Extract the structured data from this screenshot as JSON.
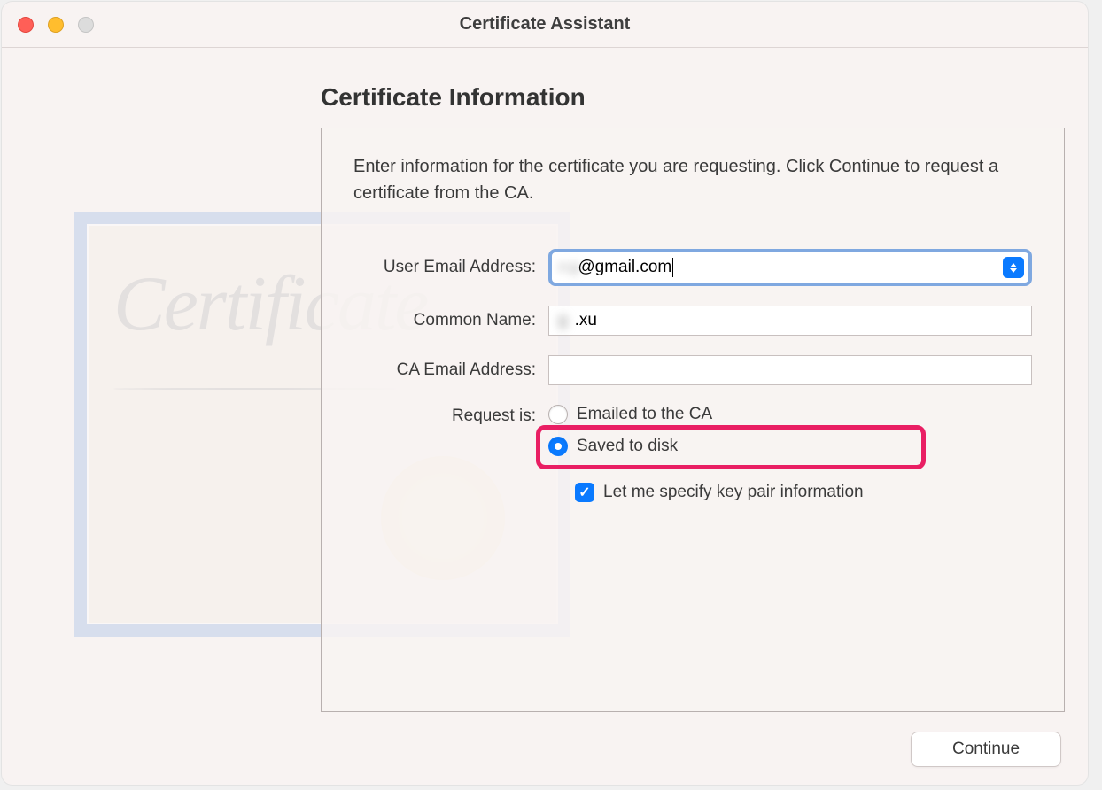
{
  "window": {
    "title": "Certificate Assistant"
  },
  "main": {
    "heading": "Certificate Information",
    "description": "Enter information for the certificate you are requesting. Click Continue to request a certificate from the CA.",
    "labels": {
      "email": "User Email Address:",
      "common_name": "Common Name:",
      "ca_email": "CA Email Address:",
      "request": "Request is:"
    },
    "fields": {
      "email_hidden_prefix": "x g ",
      "email_visible_suffix": "@gmail.com",
      "common_name_hidden_prefix": "g",
      "common_name_visible_suffix": ".xu",
      "ca_email": ""
    },
    "radio": {
      "emailed": "Emailed to the CA",
      "saved": "Saved to disk",
      "selected": "saved"
    },
    "checkbox": {
      "key_pair_label": "Let me specify key pair information",
      "key_pair_checked": true
    }
  },
  "footer": {
    "continue_label": "Continue"
  },
  "decoration": {
    "cert_text": "Certificate"
  }
}
